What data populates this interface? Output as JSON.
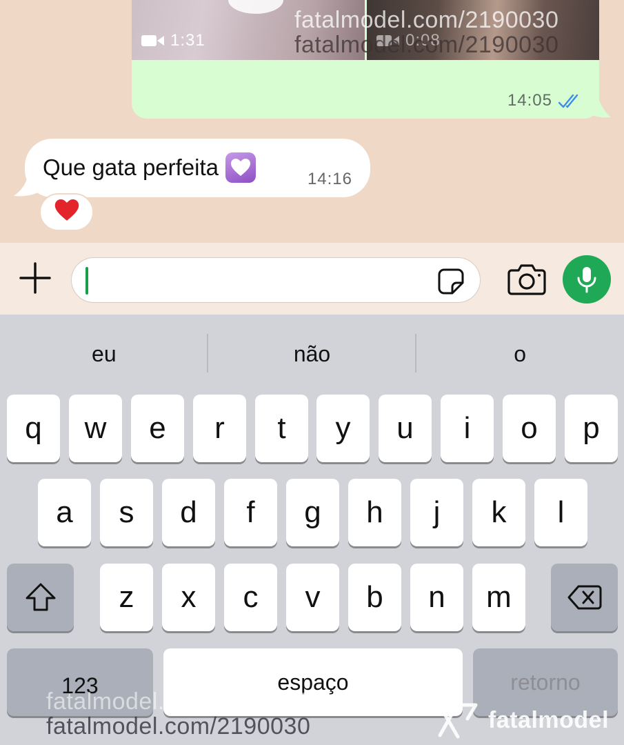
{
  "chat": {
    "outgoing": {
      "videos": [
        {
          "duration": "1:31",
          "icon": "video-camera-icon"
        },
        {
          "duration": "0:08",
          "icon": "video-camera-icon"
        }
      ],
      "time": "14:05",
      "status_icon": "double-check-icon",
      "status_color": "#3b8cf2"
    },
    "incoming": {
      "text": "Que gata perfeita",
      "emoji": "purple-heart-emoji",
      "time": "14:16",
      "reaction": "❤️"
    }
  },
  "input_bar": {
    "plus_icon": "plus-icon",
    "message_value": "",
    "sticker_icon": "sticker-icon",
    "camera_icon": "camera-icon",
    "mic_icon": "microphone-icon",
    "mic_color": "#1fa855"
  },
  "keyboard": {
    "suggestions": [
      "eu",
      "não",
      "o"
    ],
    "row1": [
      "q",
      "w",
      "e",
      "r",
      "t",
      "y",
      "u",
      "i",
      "o",
      "p"
    ],
    "row2": [
      "a",
      "s",
      "d",
      "f",
      "g",
      "h",
      "j",
      "k",
      "l"
    ],
    "row3": [
      "z",
      "x",
      "c",
      "v",
      "b",
      "n",
      "m"
    ],
    "shift_icon": "shift-icon",
    "backspace_icon": "backspace-icon",
    "numbers_label": "123",
    "space_label": "espaço",
    "return_label": "retorno"
  },
  "watermarks": {
    "line": "fatalmodel.com/2190030",
    "brand": "fatalmodel"
  }
}
